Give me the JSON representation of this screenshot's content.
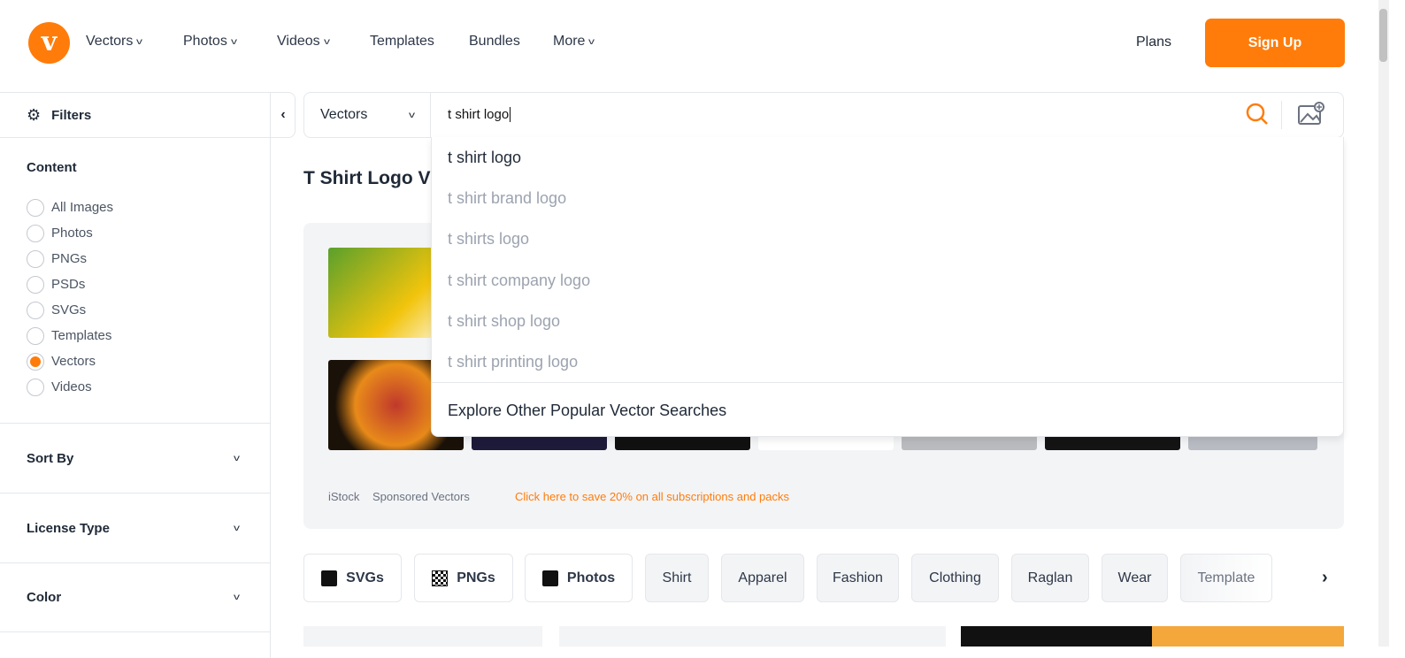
{
  "brand": {
    "logo_letter": "v",
    "accent": "#ff7c0a"
  },
  "nav": {
    "items": [
      {
        "label": "Vectors",
        "dropdown": true
      },
      {
        "label": "Photos",
        "dropdown": true
      },
      {
        "label": "Videos",
        "dropdown": true
      },
      {
        "label": "Templates"
      },
      {
        "label": "Bundles"
      },
      {
        "label": "More",
        "dropdown": true
      }
    ],
    "plans": "Plans",
    "signup": "Sign Up"
  },
  "filters": {
    "title": "Filters",
    "content_title": "Content",
    "options": [
      "All Images",
      "Photos",
      "PNGs",
      "PSDs",
      "SVGs",
      "Templates",
      "Vectors",
      "Videos"
    ],
    "selected": "Vectors",
    "accordions": [
      "Sort By",
      "License Type",
      "Color"
    ]
  },
  "search": {
    "type": "Vectors",
    "value": "t shirt logo",
    "suggestions": [
      "t shirt logo",
      "t shirt brand logo",
      "t shirts logo",
      "t shirt company logo",
      "t shirt shop logo",
      "t shirt printing logo"
    ],
    "explore": "Explore Other Popular Vector Searches"
  },
  "page_title": "T Shirt Logo V",
  "promo": {
    "source": "iStock",
    "label": "Sponsored Vectors",
    "link": "Click here to save 20% on all subscriptions and packs"
  },
  "chips": [
    {
      "label": "SVGs",
      "icon": "svg-icon"
    },
    {
      "label": "PNGs",
      "icon": "checker-icon"
    },
    {
      "label": "Photos",
      "icon": "photo-icon"
    },
    {
      "label": "Shirt"
    },
    {
      "label": "Apparel"
    },
    {
      "label": "Fashion"
    },
    {
      "label": "Clothing"
    },
    {
      "label": "Raglan"
    },
    {
      "label": "Wear"
    },
    {
      "label": "Template"
    }
  ]
}
